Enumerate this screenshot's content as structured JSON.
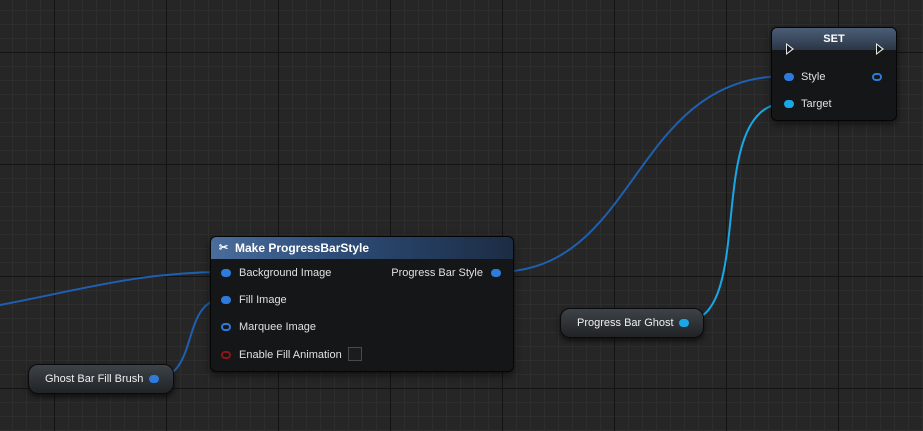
{
  "make_node": {
    "title": "Make ProgressBarStyle",
    "inputs": [
      "Background Image",
      "Fill Image",
      "Marquee Image",
      "Enable Fill Animation"
    ],
    "output": "Progress Bar Style"
  },
  "set_node": {
    "title": "SET",
    "pin_style": "Style",
    "pin_target": "Target"
  },
  "ghost_fill_node": {
    "label": "Ghost Bar Fill Brush"
  },
  "progress_ghost_node": {
    "label": "Progress Bar Ghost"
  },
  "colors": {
    "struct_pin": "#2d7bdc",
    "object_pin": "#1aa7e8",
    "bool_pin": "#8a1616",
    "wire_struct": "#1f5fb0",
    "wire_object": "#1aa7e8"
  },
  "icons": {
    "make_struct": "make-struct-icon",
    "exec_in": "exec-in-icon",
    "exec_out": "exec-out-icon"
  }
}
